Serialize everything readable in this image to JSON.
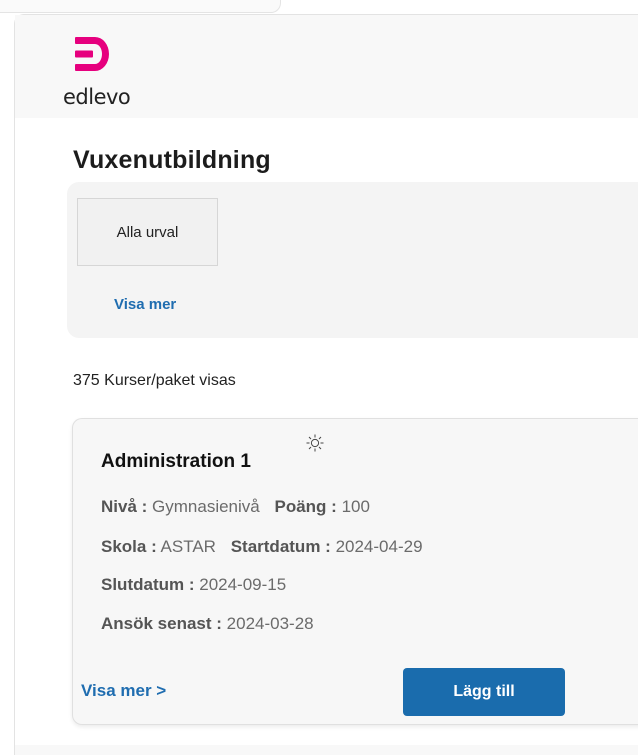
{
  "brand": {
    "logo_text": "edlevo",
    "logo_color": "#e6007e"
  },
  "page": {
    "title": "Vuxenutbildning"
  },
  "filters": {
    "chip_label": "Alla urval",
    "more_label": "Visa mer"
  },
  "results": {
    "count_text": "375 Kurser/paket visas"
  },
  "course": {
    "title": "Administration 1",
    "status_icon": "sun-icon",
    "fields": {
      "niva_label": "Nivå :",
      "niva_value": "Gymnasienivå",
      "poang_label": "Poäng :",
      "poang_value": "100",
      "skola_label": "Skola :",
      "skola_value": "ASTAR",
      "startdatum_label": "Startdatum :",
      "startdatum_value": "2024-04-29",
      "slutdatum_label": "Slutdatum :",
      "slutdatum_value": "2024-09-15",
      "ansok_label": "Ansök senast :",
      "ansok_value": "2024-03-28"
    },
    "more_label": "Visa mer >",
    "add_label": "Lägg till"
  },
  "colors": {
    "accent_link": "#1f6db0",
    "button": "#1a6cad"
  }
}
